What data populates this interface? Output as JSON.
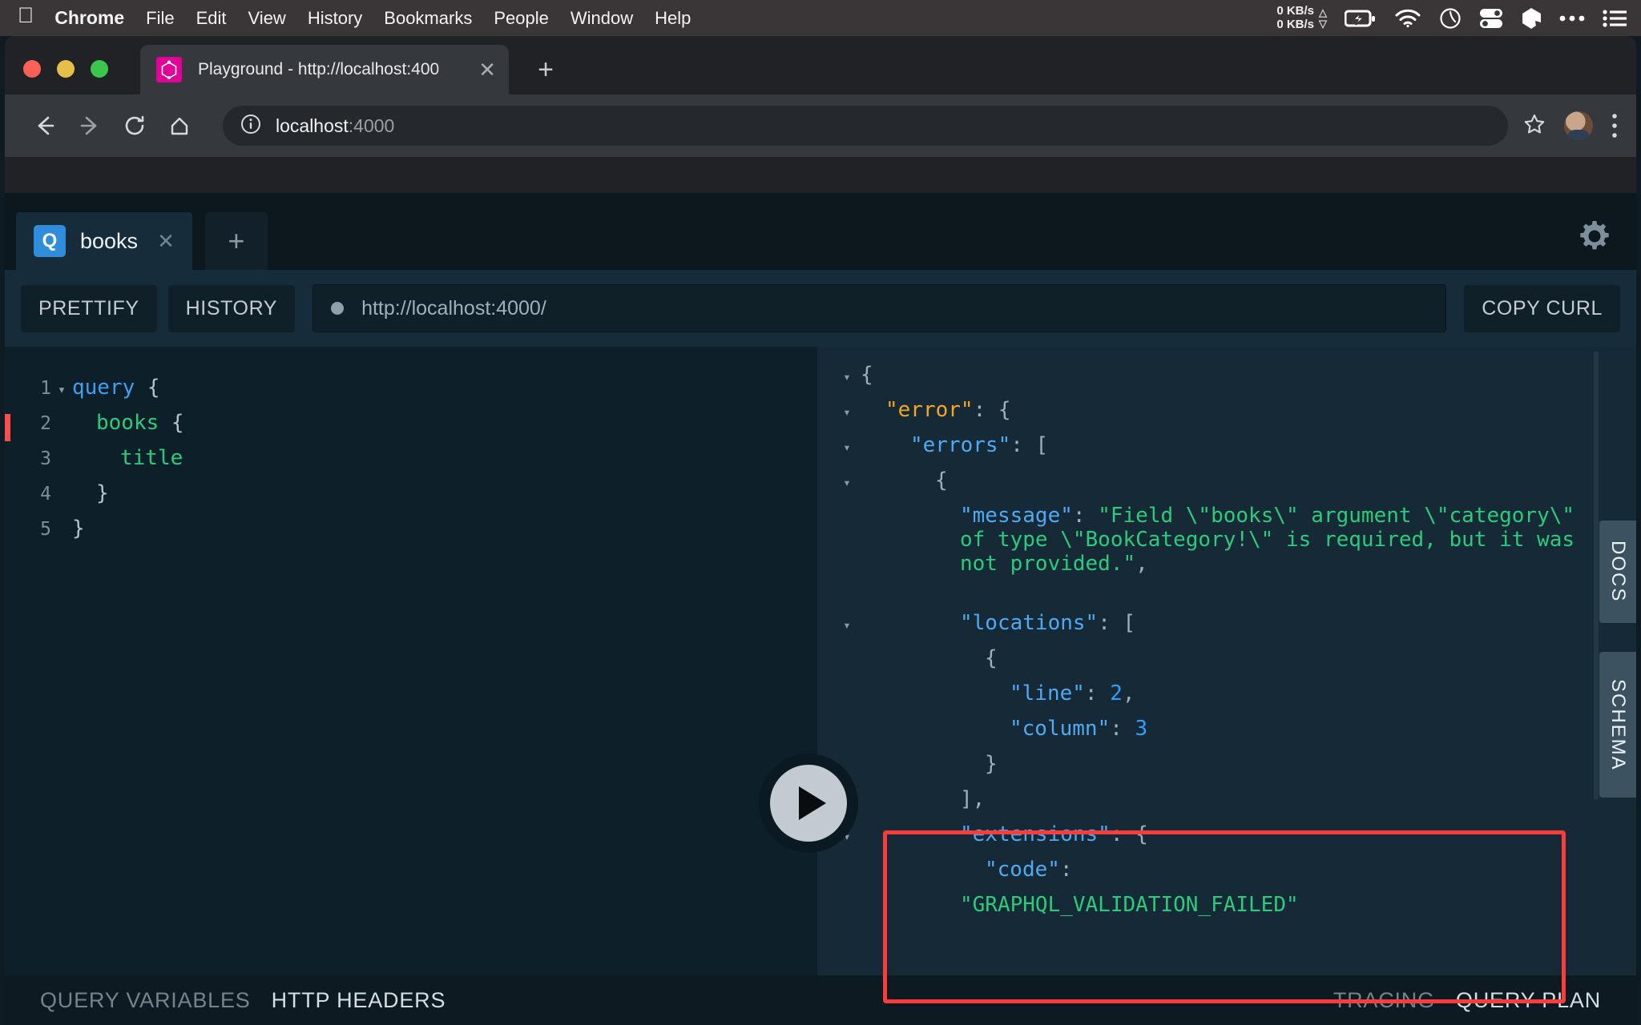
{
  "menubar": {
    "apple_icon": "apple-logo",
    "items": [
      {
        "label": "Chrome",
        "bold": true
      },
      {
        "label": "File",
        "bold": false
      },
      {
        "label": "Edit",
        "bold": false
      },
      {
        "label": "View",
        "bold": false
      },
      {
        "label": "History",
        "bold": false
      },
      {
        "label": "Bookmarks",
        "bold": false
      },
      {
        "label": "People",
        "bold": false
      },
      {
        "label": "Window",
        "bold": false
      },
      {
        "label": "Help",
        "bold": false
      }
    ],
    "network": {
      "up": "0 KB/s",
      "down": "0 KB/s"
    },
    "status_icons": [
      "battery-charging-icon",
      "wifi-icon",
      "clock-icon",
      "control-center-icon",
      "dropbox-icon",
      "ellipsis-icon",
      "list-icon"
    ]
  },
  "browser": {
    "traffic_lights": [
      "close-button",
      "minimize-button",
      "maximize-button"
    ],
    "tab": {
      "title": "Playground - http://localhost:400",
      "favicon": "graphql-icon",
      "close_icon": "close-icon"
    },
    "new_tab_icon": "plus-icon",
    "nav": {
      "back_icon": "back-arrow-icon",
      "forward_icon": "forward-arrow-icon",
      "reload_icon": "reload-icon",
      "home_icon": "home-icon"
    },
    "omnibox": {
      "info_icon": "info-circle-icon",
      "host": "localhost",
      "port": ":4000"
    },
    "bookmark_icon": "star-icon",
    "profile_icon": "avatar",
    "menu_icon": "kebab-menu-icon"
  },
  "playground": {
    "tab": {
      "badge": "Q",
      "label": "books",
      "close_icon": "close-icon"
    },
    "new_tab_icon": "plus-icon",
    "settings_icon": "gear-icon",
    "toolbar": {
      "prettify": "PRETTIFY",
      "history": "HISTORY",
      "url": "http://localhost:4000/",
      "copy_curl": "COPY CURL"
    },
    "editor": {
      "lines": [
        {
          "num": "1",
          "fold": "▾",
          "indent": 0,
          "parts": [
            {
              "t": "query",
              "c": "kw"
            },
            {
              "t": " {",
              "c": "punct"
            }
          ]
        },
        {
          "num": "2",
          "fold": "",
          "indent": 1,
          "error": true,
          "parts": [
            {
              "t": "books",
              "c": "fld"
            },
            {
              "t": " {",
              "c": "punct"
            }
          ]
        },
        {
          "num": "3",
          "fold": "",
          "indent": 2,
          "parts": [
            {
              "t": "title",
              "c": "fld"
            }
          ]
        },
        {
          "num": "4",
          "fold": "",
          "indent": 1,
          "parts": [
            {
              "t": "}",
              "c": "punct"
            }
          ]
        },
        {
          "num": "5",
          "fold": "",
          "indent": 0,
          "parts": [
            {
              "t": "}",
              "c": "punct"
            }
          ]
        }
      ]
    },
    "run_button": "play-icon",
    "result": {
      "lines": [
        {
          "fold": "▾",
          "indent": 0,
          "parts": [
            {
              "t": "{",
              "c": "brace"
            }
          ]
        },
        {
          "fold": "▾",
          "indent": 1,
          "parts": [
            {
              "t": "\"error\"",
              "c": "k-orange"
            },
            {
              "t": ": {",
              "c": "brace"
            }
          ]
        },
        {
          "fold": "▾",
          "indent": 2,
          "parts": [
            {
              "t": "\"errors\"",
              "c": "k-blue"
            },
            {
              "t": ": [",
              "c": "brace"
            }
          ]
        },
        {
          "fold": "▾",
          "indent": 3,
          "parts": [
            {
              "t": "{",
              "c": "brace"
            }
          ]
        },
        {
          "fold": "",
          "indent": 4,
          "wrap": true,
          "parts": [
            {
              "t": "\"message\"",
              "c": "k-blue"
            },
            {
              "t": ": ",
              "c": "brace"
            },
            {
              "t": "\"Field \\\"books\\\" argument \\\"category\\\" of type \\\"BookCategory!\\\" is required, but it was not provided.\"",
              "c": "v-green"
            },
            {
              "t": ",",
              "c": "brace"
            }
          ]
        },
        {
          "fold": "▾",
          "indent": 4,
          "parts": [
            {
              "t": "\"locations\"",
              "c": "k-blue"
            },
            {
              "t": ": [",
              "c": "brace"
            }
          ]
        },
        {
          "fold": "",
          "indent": 5,
          "parts": [
            {
              "t": "{",
              "c": "brace"
            }
          ]
        },
        {
          "fold": "",
          "indent": 6,
          "parts": [
            {
              "t": "\"line\"",
              "c": "k-blue"
            },
            {
              "t": ": ",
              "c": "brace"
            },
            {
              "t": "2",
              "c": "v-num"
            },
            {
              "t": ",",
              "c": "brace"
            }
          ]
        },
        {
          "fold": "",
          "indent": 6,
          "parts": [
            {
              "t": "\"column\"",
              "c": "k-blue"
            },
            {
              "t": ": ",
              "c": "brace"
            },
            {
              "t": "3",
              "c": "v-num"
            }
          ]
        },
        {
          "fold": "",
          "indent": 5,
          "parts": [
            {
              "t": "}",
              "c": "brace"
            }
          ]
        },
        {
          "fold": "",
          "indent": 4,
          "parts": [
            {
              "t": "],",
              "c": "brace"
            }
          ]
        },
        {
          "fold": "▾",
          "indent": 4,
          "parts": [
            {
              "t": "\"extensions\"",
              "c": "k-blue"
            },
            {
              "t": ": {",
              "c": "brace"
            }
          ]
        },
        {
          "fold": "",
          "indent": 5,
          "parts": [
            {
              "t": "\"code\"",
              "c": "k-blue"
            },
            {
              "t": ":",
              "c": "brace"
            }
          ]
        },
        {
          "fold": "",
          "indent": 4,
          "parts": [
            {
              "t": "\"GRAPHQL_VALIDATION_FAILED\"",
              "c": "v-green"
            }
          ]
        }
      ],
      "error_highlight_color": "#fc3b3b"
    },
    "side_tabs": [
      {
        "label": "DOCS",
        "id": "docs"
      },
      {
        "label": "SCHEMA",
        "id": "schema"
      }
    ],
    "footer": {
      "left": [
        {
          "label": "QUERY VARIABLES",
          "active": false
        },
        {
          "label": "HTTP HEADERS",
          "active": true
        }
      ],
      "right": [
        {
          "label": "TRACING",
          "active": false
        },
        {
          "label": "QUERY PLAN",
          "active": true
        }
      ]
    }
  },
  "colors": {
    "accent_blue": "#2f8ddb",
    "error_red": "#fc3b3b",
    "graphql_pink": "#e10098",
    "string_green": "#2bcb7b",
    "key_orange": "#f5a623"
  }
}
